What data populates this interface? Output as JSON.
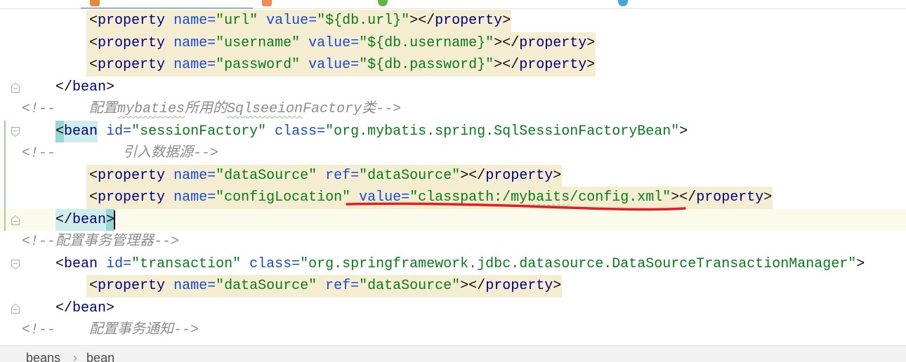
{
  "tabs": {
    "items": [
      {
        "icon": "spring-xml-file-icon",
        "color": "#e38b3a",
        "active": true
      },
      {
        "icon": "xml-file-icon",
        "color": "#f28b54",
        "active": false
      },
      {
        "icon": "java-class-icon",
        "color": "#62b543",
        "active": false
      },
      {
        "icon": "java-interface-icon",
        "color": "#40a6e0",
        "active": false
      }
    ]
  },
  "editor": {
    "lines": [
      {
        "lead": "        ",
        "highlight": true,
        "tokens": [
          {
            "p": "<"
          },
          {
            "tag": "property"
          },
          {
            "p": " "
          },
          {
            "attr": "name="
          },
          {
            "val": "\"url\""
          },
          {
            "p": " "
          },
          {
            "attr": "value="
          },
          {
            "val": "\"${db.url}\""
          },
          {
            "p": "></"
          },
          {
            "tag": "property"
          },
          {
            "p": ">"
          }
        ]
      },
      {
        "lead": "        ",
        "highlight": true,
        "tokens": [
          {
            "p": "<"
          },
          {
            "tag": "property"
          },
          {
            "p": " "
          },
          {
            "attr": "name="
          },
          {
            "val": "\"username\""
          },
          {
            "p": " "
          },
          {
            "attr": "value="
          },
          {
            "val": "\"${db.username}\""
          },
          {
            "p": "></"
          },
          {
            "tag": "property"
          },
          {
            "p": ">"
          }
        ]
      },
      {
        "lead": "        ",
        "highlight": true,
        "tokens": [
          {
            "p": "<"
          },
          {
            "tag": "property"
          },
          {
            "p": " "
          },
          {
            "attr": "name="
          },
          {
            "val": "\"password\""
          },
          {
            "p": " "
          },
          {
            "attr": "value="
          },
          {
            "val": "\"${db.password}\""
          },
          {
            "p": "></"
          },
          {
            "tag": "property"
          },
          {
            "p": ">"
          }
        ]
      },
      {
        "lead": "    ",
        "fold_close": true,
        "tokens": [
          {
            "p": "</"
          },
          {
            "tag": "bean"
          },
          {
            "p": ">"
          }
        ]
      },
      {
        "lead": "",
        "tokens": [
          {
            "cm": "<!--    配置"
          },
          {
            "cm": "mybaties",
            "typo": true
          },
          {
            "cm": "所用的"
          },
          {
            "cm": "Sqlseeion",
            "typo": true
          },
          {
            "cm": "Factory类-->"
          }
        ]
      },
      {
        "lead": "    ",
        "fold_open": true,
        "changed": true,
        "tokens": [
          {
            "p": "<",
            "match": 2
          },
          {
            "tag": "bean",
            "match": 1
          },
          {
            "p": " "
          },
          {
            "attr": "id="
          },
          {
            "val": "\"sessionFactory\""
          },
          {
            "p": " "
          },
          {
            "attr": "class="
          },
          {
            "val": "\"org.mybatis.spring.SqlSessionFactoryBean\""
          },
          {
            "p": ">"
          }
        ]
      },
      {
        "lead": "",
        "changed": true,
        "tokens": [
          {
            "cm": "<!--        引入数据源-->"
          }
        ]
      },
      {
        "lead": "        ",
        "highlight": true,
        "changed": true,
        "tokens": [
          {
            "p": "<"
          },
          {
            "tag": "property"
          },
          {
            "p": " "
          },
          {
            "attr": "name="
          },
          {
            "val": "\"dataSource\""
          },
          {
            "p": " "
          },
          {
            "attr": "ref="
          },
          {
            "val": "\"dataSource\""
          },
          {
            "p": "></"
          },
          {
            "tag": "property"
          },
          {
            "p": ">"
          }
        ]
      },
      {
        "lead": "        ",
        "highlight": true,
        "changed": true,
        "tokens": [
          {
            "p": "<"
          },
          {
            "tag": "property"
          },
          {
            "p": " "
          },
          {
            "attr": "name="
          },
          {
            "val": "\"configLocation\""
          },
          {
            "p": " "
          },
          {
            "attr": "value="
          },
          {
            "val": "\"classpath:/"
          },
          {
            "val": "mybaits",
            "typo": true
          },
          {
            "val": "/config.xml\""
          },
          {
            "p": "></"
          },
          {
            "tag": "property"
          },
          {
            "p": ">"
          }
        ]
      },
      {
        "lead": "    ",
        "fold_close": true,
        "changed": true,
        "current": true,
        "caret": true,
        "tokens": [
          {
            "p": "</",
            "match": 1
          },
          {
            "tag": "bean",
            "match": 1
          },
          {
            "p": ">",
            "match": 2
          }
        ]
      },
      {
        "lead": "",
        "tokens": [
          {
            "cm": "<!--配置事务管理器-->"
          }
        ]
      },
      {
        "lead": "    ",
        "fold_open": true,
        "tokens": [
          {
            "p": "<"
          },
          {
            "tag": "bean"
          },
          {
            "p": " "
          },
          {
            "attr": "id="
          },
          {
            "val": "\"transaction\""
          },
          {
            "p": " "
          },
          {
            "attr": "class="
          },
          {
            "val": "\"org.springframework.jdbc.datasource.DataSourceTransactionManager\""
          },
          {
            "p": ">"
          }
        ]
      },
      {
        "lead": "        ",
        "highlight": true,
        "tokens": [
          {
            "p": "<"
          },
          {
            "tag": "property"
          },
          {
            "p": " "
          },
          {
            "attr": "name="
          },
          {
            "val": "\"dataSource\""
          },
          {
            "p": " "
          },
          {
            "attr": "ref="
          },
          {
            "val": "\"dataSource\""
          },
          {
            "p": "></"
          },
          {
            "tag": "property"
          },
          {
            "p": ">"
          }
        ]
      },
      {
        "lead": "    ",
        "fold_close": true,
        "tokens": [
          {
            "p": "</"
          },
          {
            "tag": "bean"
          },
          {
            "p": ">"
          }
        ]
      },
      {
        "lead": "",
        "tokens": [
          {
            "cm": "<!--    配置事务通知-->"
          }
        ]
      }
    ]
  },
  "breadcrumb": {
    "items": [
      "beans",
      "bean"
    ],
    "separator": "›"
  },
  "annotation": {
    "color": "#e01f1f"
  }
}
